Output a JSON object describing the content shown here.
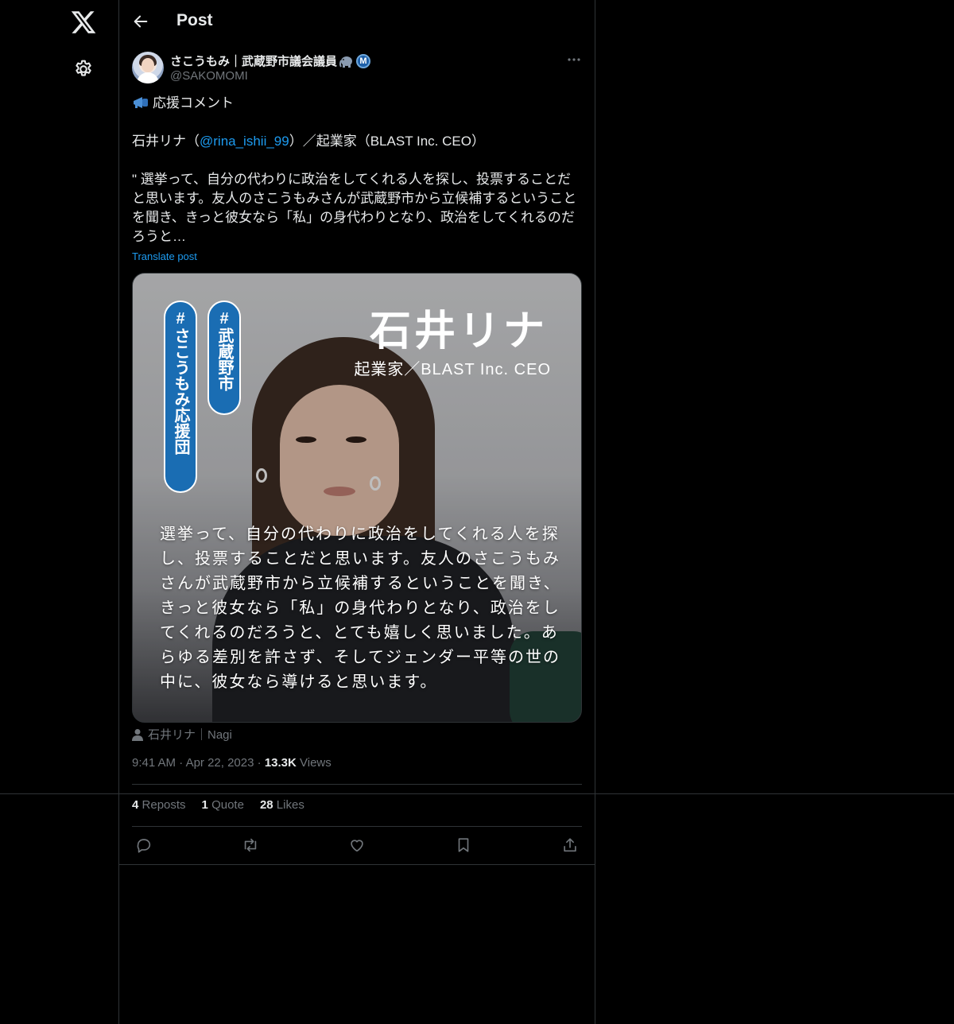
{
  "nav": {
    "logo_icon": "x-logo-icon",
    "settings_icon": "gear-icon"
  },
  "header": {
    "title": "Post",
    "back_icon": "arrow-left-icon"
  },
  "post": {
    "author_name": "さこうもみ｜武蔵野市議会議員",
    "author_handle": "@SAKOMOMI",
    "line1": "応援コメント",
    "line2_prefix": "石井リナ（",
    "line2_mention": "@rina_ishii_99",
    "line2_suffix": "）／起業家（BLAST Inc. CEO）",
    "body": "\" 選挙って、自分の代わりに政治をしてくれる人を探し、投票することだと思います。友人のさこうもみさんが武蔵野市から立候補するということを聞き、きっと彼女なら「私」の身代わりとなり、政治をしてくれるのだろうと…",
    "translate_label": "Translate post",
    "media": {
      "pill_1": "#さこうもみ応援団",
      "pill_2": "#武蔵野市",
      "name": "石井リナ",
      "role": "起業家／BLAST Inc. CEO",
      "quote": "選挙って、自分の代わりに政治をしてくれる人を探し、投票することだと思います。友人のさこうもみさんが武蔵野市から立候補するということを聞き、きっと彼女なら「私」の身代わりとなり、政治をしてくれるのだろうと、とても嬉しく思いました。あらゆる差別を許さず、そしてジェンダー平等の世の中に、彼女なら導けると思います。"
    },
    "tagged_users": "石井リナ｜Nagi",
    "time": "9:41 AM",
    "date": "Apr 22, 2023",
    "views_count": "13.3K",
    "views_label": "Views",
    "reposts_count": "4",
    "reposts_label": "Reposts",
    "quotes_count": "1",
    "quotes_label": "Quote",
    "likes_count": "28",
    "likes_label": "Likes"
  },
  "colors": {
    "background": "#000000",
    "text": "#e7e9ea",
    "muted": "#71767b",
    "link": "#1d9bf0",
    "border": "#2f3336",
    "pill_blue": "#1a6db3"
  }
}
